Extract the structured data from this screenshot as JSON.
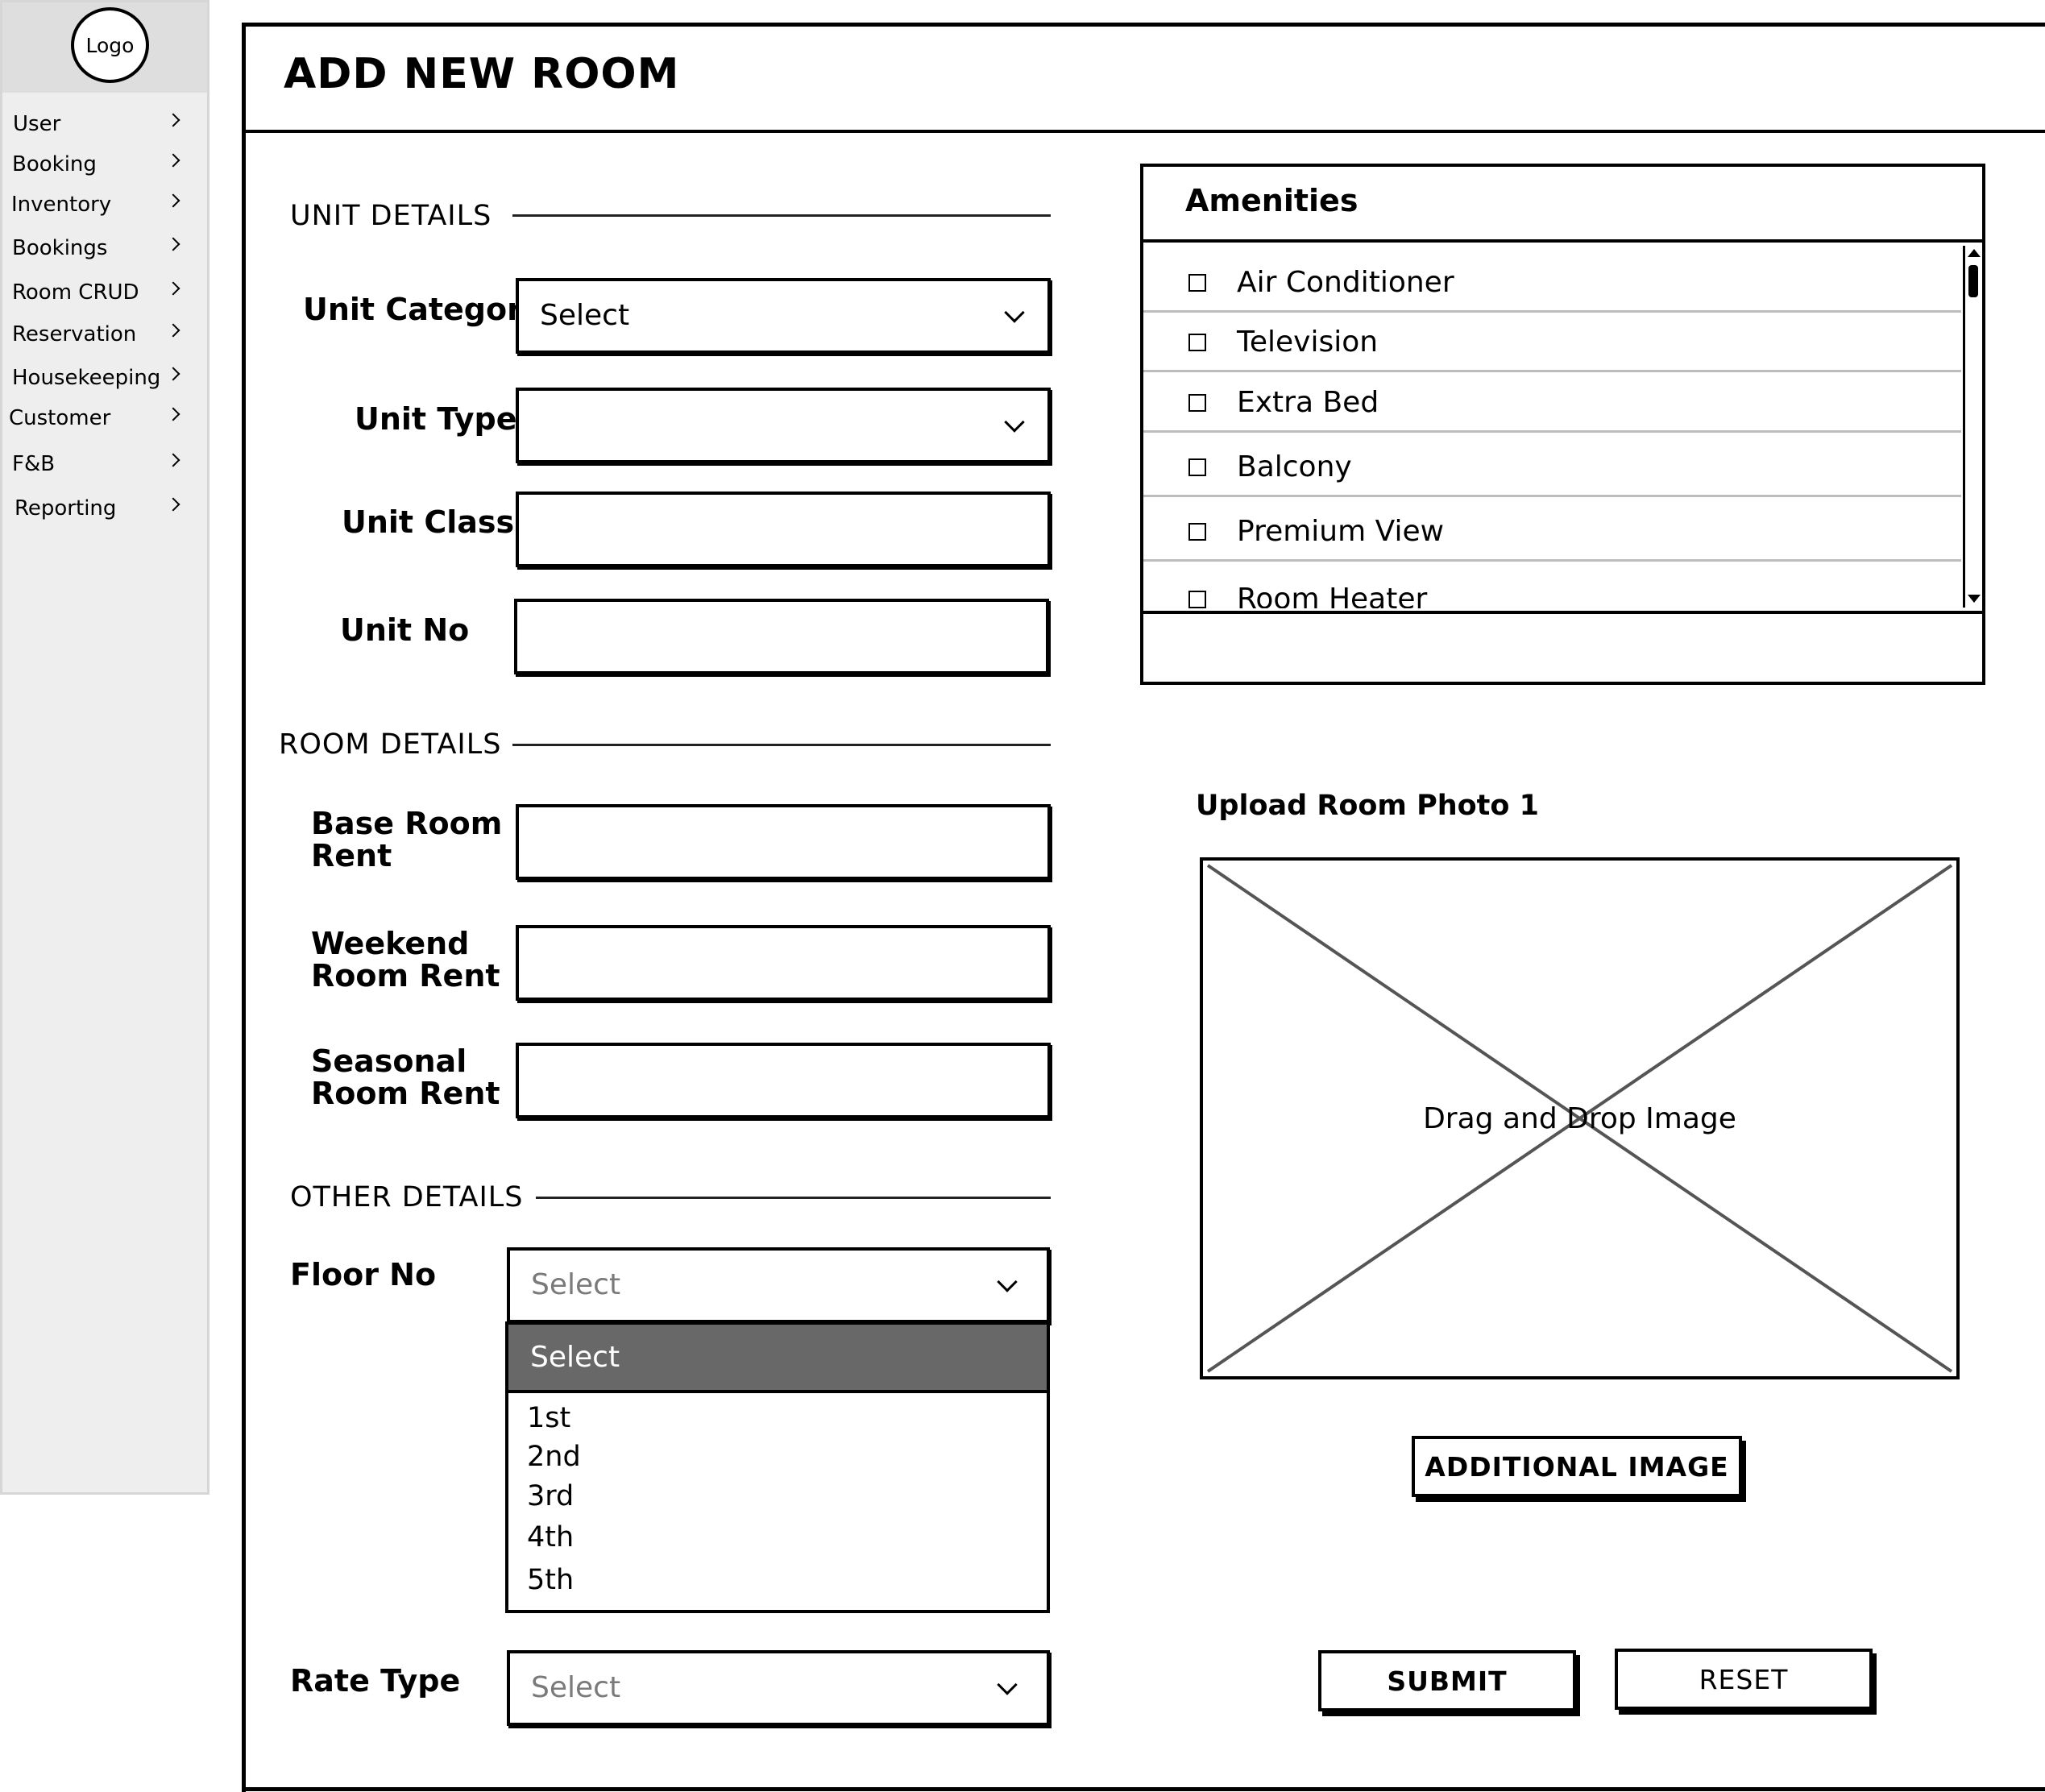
{
  "sidebar": {
    "logo": "Logo",
    "items": [
      {
        "label": "User"
      },
      {
        "label": "Booking"
      },
      {
        "label": "Inventory"
      },
      {
        "label": "Bookings"
      },
      {
        "label": "Room CRUD"
      },
      {
        "label": "Reservation"
      },
      {
        "label": "Housekeeping"
      },
      {
        "label": "Customer"
      },
      {
        "label": "F&B"
      },
      {
        "label": "Reporting"
      }
    ]
  },
  "page": {
    "title": "ADD NEW ROOM"
  },
  "sections": {
    "unit": "UNIT DETAILS",
    "room": "ROOM DETAILS",
    "other": "OTHER DETAILS"
  },
  "fields": {
    "unit_category": {
      "label": "Unit Category",
      "value": "Select"
    },
    "unit_type": {
      "label": "Unit Type",
      "value": ""
    },
    "unit_class": {
      "label": "Unit Class",
      "value": ""
    },
    "unit_no": {
      "label": "Unit No",
      "value": ""
    },
    "base_room_rent": {
      "label_line1": "Base Room",
      "label_line2": "Rent",
      "value": ""
    },
    "weekend_room_rent": {
      "label_line1": "Weekend",
      "label_line2": "Room Rent",
      "value": ""
    },
    "seasonal_room_rent": {
      "label_line1": "Seasonal",
      "label_line2": "Room Rent",
      "value": ""
    },
    "floor_no": {
      "label": "Floor No",
      "placeholder": "Select",
      "highlighted": "Select",
      "options": [
        "1st",
        "2nd",
        "3rd",
        "4th",
        "5th"
      ]
    },
    "rate_type": {
      "label": "Rate Type",
      "placeholder": "Select"
    }
  },
  "amenities": {
    "title": "Amenities",
    "items": [
      {
        "label": "Air Conditioner",
        "checked": false
      },
      {
        "label": "Television",
        "checked": false
      },
      {
        "label": "Extra Bed",
        "checked": false
      },
      {
        "label": "Balcony",
        "checked": false
      },
      {
        "label": "Premium View",
        "checked": false
      },
      {
        "label": "Room Heater",
        "checked": false
      }
    ]
  },
  "upload": {
    "label": "Upload Room Photo 1",
    "drop_text": "Drag and Drop Image"
  },
  "buttons": {
    "additional_image": "ADDITIONAL IMAGE",
    "submit": "SUBMIT",
    "reset": "RESET"
  }
}
